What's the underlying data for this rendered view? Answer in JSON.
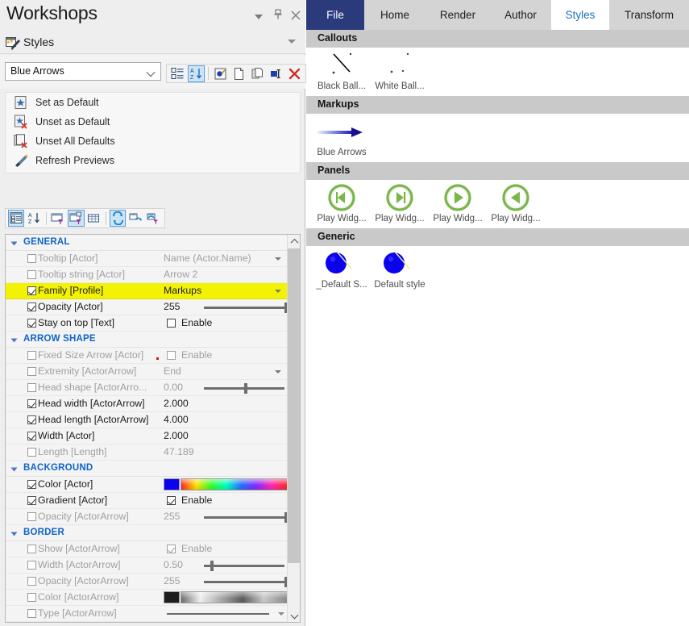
{
  "dock": {
    "title": "Workshops",
    "window_buttons": [
      {
        "name": "dropdown",
        "glyph": "▼"
      },
      {
        "name": "pin",
        "glyph": "⫶"
      },
      {
        "name": "close",
        "glyph": "✕"
      }
    ],
    "section_label": "Styles"
  },
  "style_combo": {
    "value": "Blue Arrows",
    "placeholder": "Blue Arrows"
  },
  "top_toolbar": {
    "buttons": [
      {
        "name": "group-by-category-icon",
        "label": "Group by category",
        "active": false
      },
      {
        "name": "sort-alphabetical-icon",
        "label": "Sort alphabetically",
        "active": true
      },
      {
        "name": "edit-style-icon",
        "label": "Edit style",
        "active": false
      },
      {
        "name": "new-style-icon",
        "label": "New style",
        "active": false
      },
      {
        "name": "duplicate-style-icon",
        "label": "Duplicate style",
        "active": false
      },
      {
        "name": "rename-style-icon",
        "label": "Rename style",
        "active": false
      },
      {
        "name": "delete-style-icon",
        "label": "Delete style",
        "active": false
      }
    ]
  },
  "commands": [
    {
      "icon": "set-as-default-icon",
      "label": "Set as Default"
    },
    {
      "icon": "unset-as-default-icon",
      "label": "Unset as Default"
    },
    {
      "icon": "unset-all-defaults-icon",
      "label": "Unset All Defaults"
    },
    {
      "icon": "refresh-previews-icon",
      "label": "Refresh Previews"
    }
  ],
  "grid_toolbar": {
    "buttons": [
      {
        "name": "categorized-view-icon",
        "active": true
      },
      {
        "name": "alphabetical-view-icon",
        "active": false
      },
      {
        "name": "filter-rows-icon",
        "active": false
      },
      {
        "name": "filter-columns-icon",
        "active": true
      },
      {
        "name": "table-view-icon",
        "active": false
      },
      {
        "name": "sync-all-icon",
        "active": true
      },
      {
        "name": "sync-selected-icon",
        "active": false
      },
      {
        "name": "sync-filtered-icon",
        "active": false
      }
    ]
  },
  "property_grid": {
    "groups": [
      {
        "name": "GENERAL",
        "rows": [
          {
            "checked": false,
            "dim": true,
            "name": "Tooltip [Actor]",
            "type": "dropdown",
            "value": "Name (Actor.Name)"
          },
          {
            "checked": false,
            "dim": true,
            "name": "Tooltip string [Actor]",
            "type": "text",
            "value": "Arrow 2"
          },
          {
            "checked": true,
            "dim": false,
            "name": "Family [Profile]",
            "type": "dropdown",
            "value": "Markups",
            "highlight": true
          },
          {
            "checked": true,
            "dim": false,
            "name": "Opacity [Actor]",
            "type": "slider",
            "value": "255",
            "slider_pct": 100
          },
          {
            "checked": true,
            "dim": false,
            "name": "Stay on top [Text]",
            "type": "enable",
            "value": "Enable",
            "enabled": false
          }
        ]
      },
      {
        "name": "ARROW SHAPE",
        "rows": [
          {
            "checked": false,
            "dim": true,
            "name": "Fixed Size Arrow [Actor]",
            "type": "enable",
            "value": "Enable",
            "enabled": false,
            "red_dot": true
          },
          {
            "checked": false,
            "dim": true,
            "name": "Extremity [ActorArrow]",
            "type": "dropdown",
            "value": "End"
          },
          {
            "checked": false,
            "dim": true,
            "name": "Head shape [ActorArro...",
            "type": "slider",
            "value": "0.00",
            "slider_pct": 50
          },
          {
            "checked": true,
            "dim": false,
            "name": "Head width [ActorArrow]",
            "type": "text",
            "value": "2.000"
          },
          {
            "checked": true,
            "dim": false,
            "name": "Head length [ActorArrow]",
            "type": "text",
            "value": "4.000"
          },
          {
            "checked": true,
            "dim": false,
            "name": "Width [Actor]",
            "type": "text",
            "value": "2.000"
          },
          {
            "checked": false,
            "dim": true,
            "name": "Length [Length]",
            "type": "text",
            "value": "47.189"
          }
        ]
      },
      {
        "name": "BACKGROUND",
        "rows": [
          {
            "checked": true,
            "dim": false,
            "name": "Color [Actor]",
            "type": "color",
            "value": "",
            "swatch": "#0b02f0",
            "bar": "spectrum"
          },
          {
            "checked": true,
            "dim": false,
            "name": "Gradient [Actor]",
            "type": "enable",
            "value": "Enable",
            "enabled": true
          },
          {
            "checked": false,
            "dim": true,
            "name": "Opacity [ActorArrow]",
            "type": "slider",
            "value": "255",
            "slider_pct": 100
          }
        ]
      },
      {
        "name": "BORDER",
        "rows": [
          {
            "checked": false,
            "dim": true,
            "name": "Show [ActorArrow]",
            "type": "enable",
            "value": "Enable",
            "enabled": true,
            "dim_enable": true
          },
          {
            "checked": false,
            "dim": true,
            "name": "Width [ActorArrow]",
            "type": "slider",
            "value": "0.50",
            "slider_pct": 8
          },
          {
            "checked": false,
            "dim": true,
            "name": "Opacity [ActorArrow]",
            "type": "slider",
            "value": "255",
            "slider_pct": 100
          },
          {
            "checked": false,
            "dim": true,
            "name": "Color [ActorArrow]",
            "type": "color",
            "value": "",
            "swatch": "#1d1d1d",
            "bar": "gray"
          },
          {
            "checked": false,
            "dim": true,
            "name": "Type [ActorArrow]",
            "type": "linestyle",
            "value": ""
          }
        ]
      }
    ]
  },
  "ribbon": {
    "tabs": [
      {
        "label": "File",
        "state": "file"
      },
      {
        "label": "Home",
        "state": "normal"
      },
      {
        "label": "Render",
        "state": "normal"
      },
      {
        "label": "Author",
        "state": "normal"
      },
      {
        "label": "Styles",
        "state": "active"
      },
      {
        "label": "Transform",
        "state": "normal"
      }
    ],
    "galleries": [
      {
        "name": "Callouts",
        "items": [
          {
            "label": "Black Ball...",
            "thumb": "callout-black-ball"
          },
          {
            "label": "White Ball...",
            "thumb": "callout-white-ball"
          }
        ]
      },
      {
        "name": "Markups",
        "items": [
          {
            "label": "Blue Arrows",
            "thumb": "blue-arrow"
          }
        ]
      },
      {
        "name": "Panels",
        "items": [
          {
            "label": "Play Widg...",
            "thumb": "play-first"
          },
          {
            "label": "Play Widg...",
            "thumb": "play-last"
          },
          {
            "label": "Play Widg...",
            "thumb": "play-forward"
          },
          {
            "label": "Play Widg...",
            "thumb": "play-back"
          }
        ]
      },
      {
        "name": "Generic",
        "items": [
          {
            "label": "_Default S...",
            "thumb": "blue-sphere"
          },
          {
            "label": "Default style",
            "thumb": "blue-sphere"
          }
        ]
      }
    ]
  },
  "colors": {
    "accent_blue": "#1b6ec2",
    "file_tab": "#2b3a7a",
    "group_label": "#0f64c8",
    "highlight_row": "#f2f202",
    "panel_bg": "#eeeeee",
    "gallery_header": "#c9c9c9",
    "green_ring": "#7ab648"
  }
}
